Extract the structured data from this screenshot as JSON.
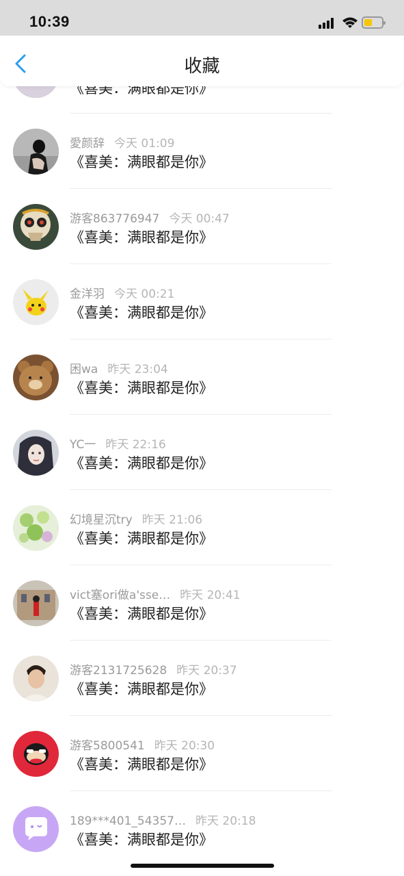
{
  "status_bar": {
    "time": "10:39"
  },
  "nav": {
    "title": "收藏"
  },
  "partial_item": {
    "content": "《喜美：满眼都是你》"
  },
  "items": [
    {
      "name": "愛颜辞",
      "time": "今天 01:09",
      "content": "《喜美：满眼都是你》",
      "avatar": "woman-sitting-photo"
    },
    {
      "name": "游客863776947",
      "time": "今天 00:47",
      "content": "《喜美：满眼都是你》",
      "avatar": "sugar-skull-photo"
    },
    {
      "name": "金洋羽",
      "time": "今天 00:21",
      "content": "《喜美：满眼都是你》",
      "avatar": "pikachu-photo"
    },
    {
      "name": "困wa",
      "time": "昨天 23:04",
      "content": "《喜美：满眼都是你》",
      "avatar": "bear-photo"
    },
    {
      "name": "YC一",
      "time": "昨天 22:16",
      "content": "《喜美：满眼都是你》",
      "avatar": "anime-girl-photo"
    },
    {
      "name": "幻境星沉try",
      "time": "昨天 21:06",
      "content": "《喜美：满眼都是你》",
      "avatar": "green-flowers-photo"
    },
    {
      "name": "vict塞ori做a'sse…",
      "time": "昨天 20:41",
      "content": "《喜美：满眼都是你》",
      "avatar": "guard-building-photo"
    },
    {
      "name": "游客2131725628",
      "time": "昨天 20:37",
      "content": "《喜美：满眼都是你》",
      "avatar": "young-man-photo"
    },
    {
      "name": "游客5800541",
      "time": "昨天 20:30",
      "content": "《喜美：满眼都是你》",
      "avatar": "monkey-logo"
    },
    {
      "name": "189***401_54357…",
      "time": "昨天 20:18",
      "content": "《喜美：满眼都是你》",
      "avatar": "chat-bubble-logo"
    }
  ],
  "colors": {
    "accent": "#2c9cf0",
    "status_bar_bg": "#dcdcdc",
    "battery_fill": "#f7c600"
  }
}
